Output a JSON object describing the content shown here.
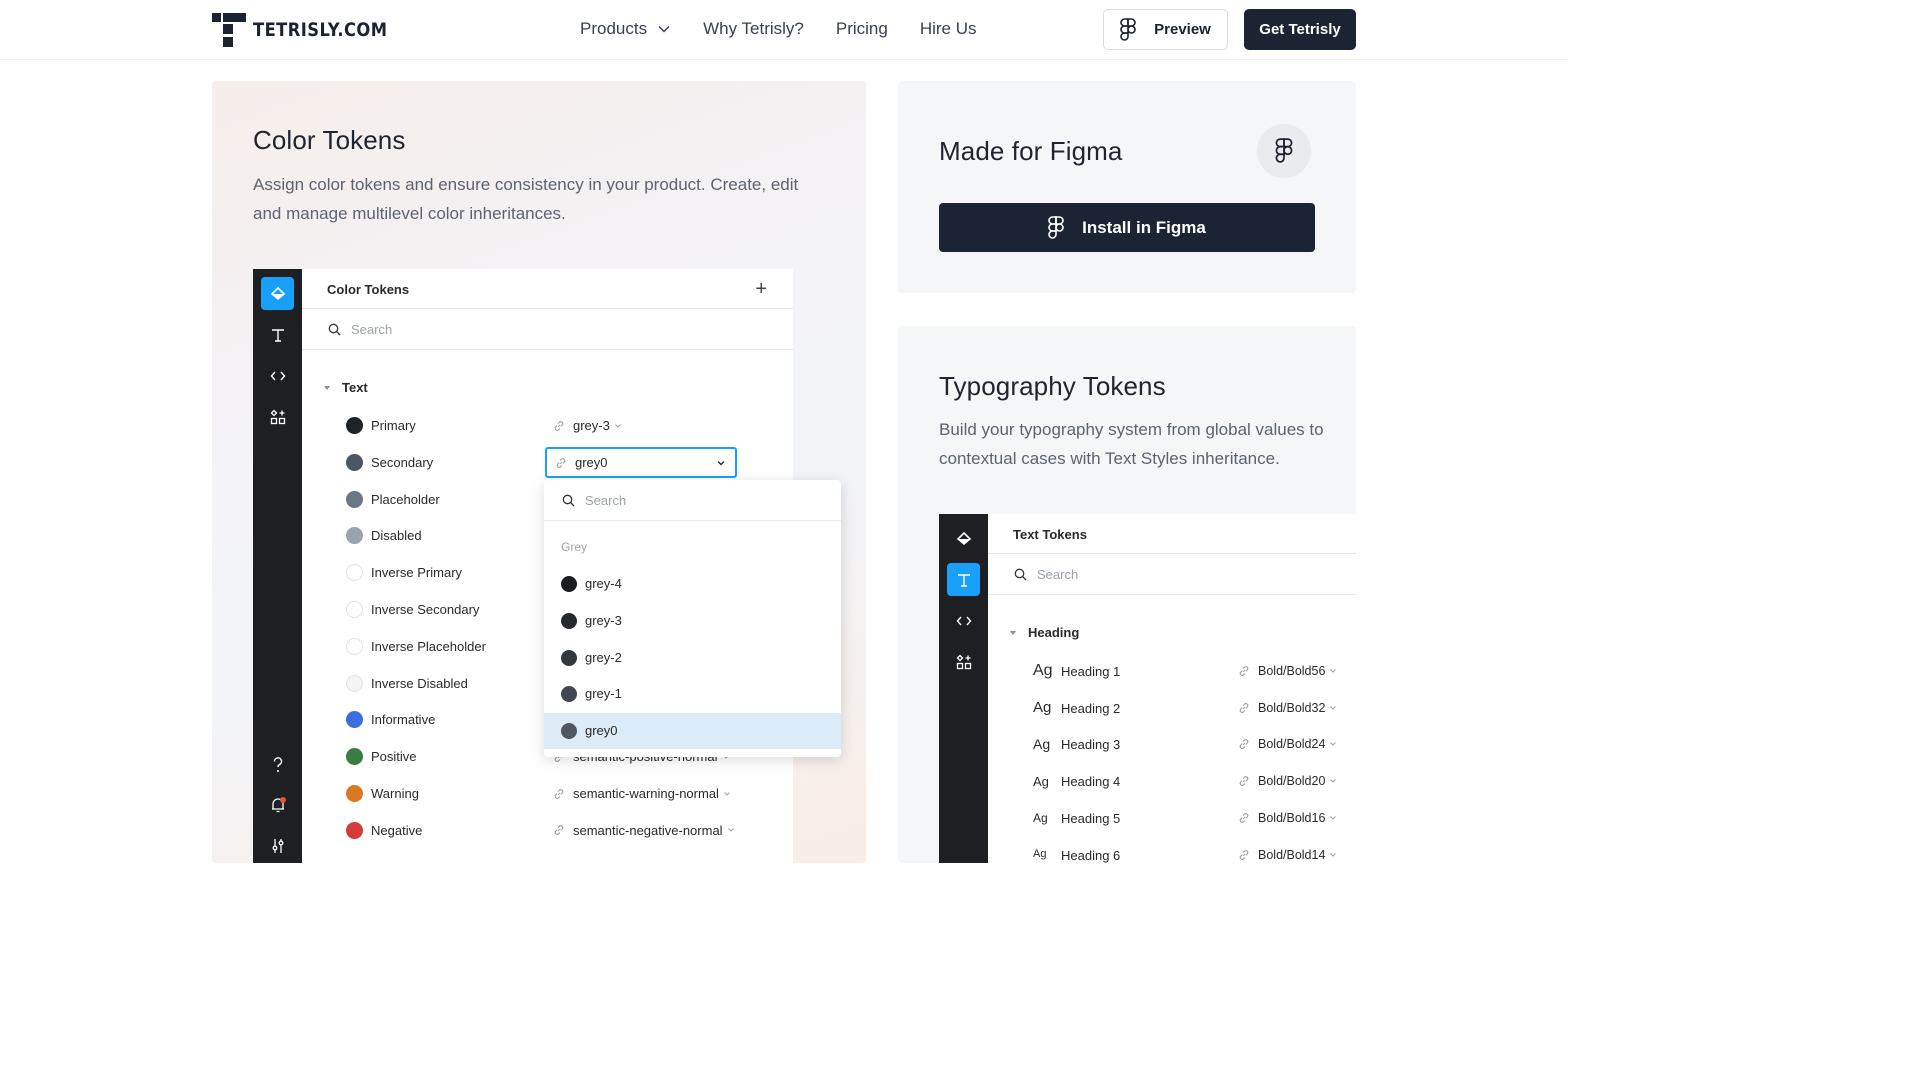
{
  "header": {
    "logo_text": "TETRISLY.COM",
    "nav": [
      {
        "label": "Products",
        "has_dropdown": true
      },
      {
        "label": "Why Tetrisly?"
      },
      {
        "label": "Pricing"
      },
      {
        "label": "Hire Us"
      }
    ],
    "preview_label": "Preview",
    "cta_label": "Get Tetrisly"
  },
  "color_card": {
    "title": "Color Tokens",
    "description": "Assign color tokens and ensure consistency in your product. Create, edit and manage multilevel color inheritances.",
    "panel": {
      "title": "Color Tokens",
      "search_placeholder": "Search",
      "group": "Text",
      "tokens": [
        {
          "name": "Primary",
          "color": "#1f2329",
          "value": "grey-3"
        },
        {
          "name": "Secondary",
          "color": "#4b5563",
          "value": "grey0",
          "editing": true
        },
        {
          "name": "Placeholder",
          "color": "#6b7785",
          "value": ""
        },
        {
          "name": "Disabled",
          "color": "#9aa3ad",
          "value": ""
        },
        {
          "name": "Inverse Primary",
          "color": "#ffffff",
          "value": ""
        },
        {
          "name": "Inverse Secondary",
          "color": "#ffffff",
          "value": ""
        },
        {
          "name": "Inverse Placeholder",
          "color": "#ffffff",
          "value": ""
        },
        {
          "name": "Inverse Disabled",
          "color": "#f4f4f4",
          "value": ""
        },
        {
          "name": "Informative",
          "color": "#3b6fe0",
          "value": ""
        },
        {
          "name": "Positive",
          "color": "#3a7d44",
          "value": "semantic-positive-normal"
        },
        {
          "name": "Warning",
          "color": "#d97a22",
          "value": "semantic-warning-normal"
        },
        {
          "name": "Negative",
          "color": "#d43a3a",
          "value": "semantic-negative-normal"
        }
      ],
      "dropdown": {
        "search_placeholder": "Search",
        "group": "Grey",
        "options": [
          {
            "name": "grey-4",
            "color": "#1a1d21"
          },
          {
            "name": "grey-3",
            "color": "#262a30"
          },
          {
            "name": "grey-2",
            "color": "#333840"
          },
          {
            "name": "grey-1",
            "color": "#414852"
          },
          {
            "name": "grey0",
            "color": "#4f5761",
            "selected": true
          }
        ]
      }
    }
  },
  "figma_card": {
    "title": "Made for Figma",
    "install_label": "Install in Figma"
  },
  "typography_card": {
    "title": "Typography Tokens",
    "description": "Build your typography system from global values to contextual cases with Text Styles inheritance.",
    "panel": {
      "title": "Text Tokens",
      "search_placeholder": "Search",
      "group": "Heading",
      "items": [
        {
          "sample": "Ag",
          "name": "Heading 1",
          "value": "Bold/Bold56"
        },
        {
          "sample": "Ag",
          "name": "Heading 2",
          "value": "Bold/Bold32"
        },
        {
          "sample": "Ag",
          "name": "Heading 3",
          "value": "Bold/Bold24"
        },
        {
          "sample": "Ag",
          "name": "Heading 4",
          "value": "Bold/Bold20"
        },
        {
          "sample": "Ag",
          "name": "Heading 5",
          "value": "Bold/Bold16"
        },
        {
          "sample": "Ag",
          "name": "Heading 6",
          "value": "Bold/Bold14"
        }
      ]
    }
  },
  "colors": {
    "brand_dark": "#1c2433",
    "accent_blue": "#18a0fb",
    "notification_dot": "#e5533d"
  },
  "icons": [
    "tetrisly-logo",
    "chevron-down-icon",
    "figma-icon",
    "fill-tool-icon",
    "text-tool-icon",
    "code-icon",
    "components-icon",
    "help-icon",
    "bell-icon",
    "sliders-icon",
    "plus-icon",
    "search-icon",
    "link-icon"
  ]
}
